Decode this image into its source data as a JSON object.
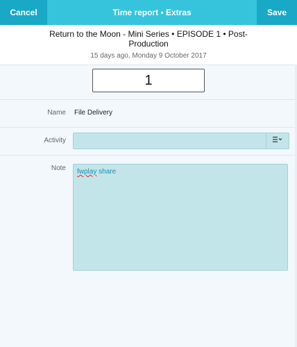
{
  "topbar": {
    "cancel_label": "Cancel",
    "title": "Time report • Extras",
    "save_label": "Save"
  },
  "header": {
    "project": "Return to the Moon - Mini Series • EPISODE 1 • Post-Production",
    "date": "15 days ago, Monday 9 October 2017"
  },
  "quantity": "1",
  "form": {
    "name_label": "Name",
    "name_value": "File Delivery",
    "activity_label": "Activity",
    "activity_value": "",
    "note_label": "Note",
    "note_word1": "fwplay",
    "note_word2": "share"
  },
  "icons": {
    "activity_menu": "list-dropdown-icon"
  },
  "colors": {
    "topbar_bg": "#36c4dc",
    "topbar_button_bg": "#19a9c6",
    "field_bg": "#c2e5ea",
    "page_bg": "#f2f8fc"
  }
}
